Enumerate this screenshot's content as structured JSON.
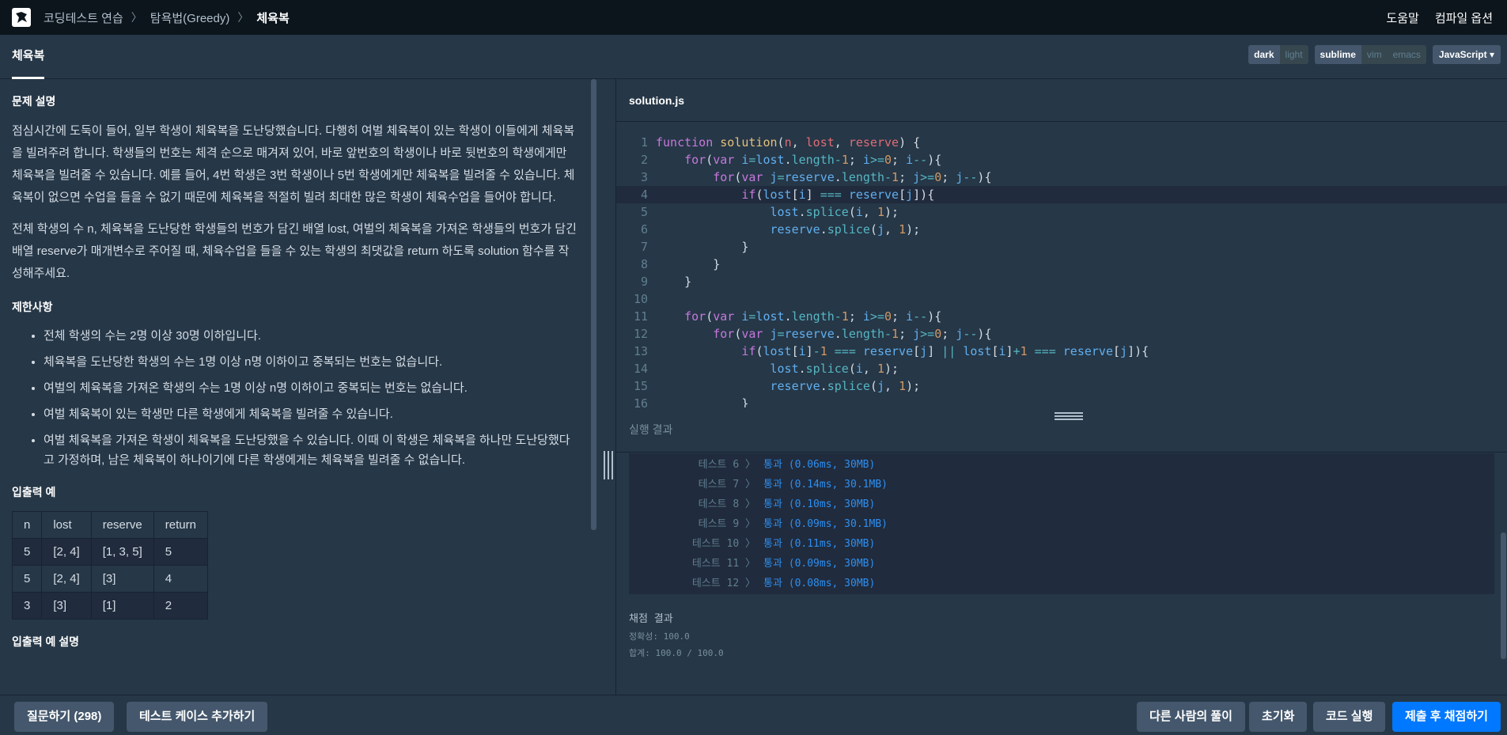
{
  "breadcrumb": {
    "items": [
      "코딩테스트 연습",
      "탐욕법(Greedy)",
      "체육복"
    ]
  },
  "top_links": {
    "help": "도움말",
    "compile_options": "컴파일 옵션"
  },
  "tab": {
    "title": "체육복"
  },
  "toggles": {
    "theme": [
      "dark",
      "light"
    ],
    "keymap": [
      "sublime",
      "vim",
      "emacs"
    ],
    "language": "JavaScript"
  },
  "problem": {
    "heading_desc": "문제 설명",
    "desc_p1": "점심시간에 도둑이 들어, 일부 학생이 체육복을 도난당했습니다. 다행히 여벌 체육복이 있는 학생이 이들에게 체육복을 빌려주려 합니다. 학생들의 번호는 체격 순으로 매겨져 있어, 바로 앞번호의 학생이나 바로 뒷번호의 학생에게만 체육복을 빌려줄 수 있습니다. 예를 들어, 4번 학생은 3번 학생이나 5번 학생에게만 체육복을 빌려줄 수 있습니다. 체육복이 없으면 수업을 들을 수 없기 때문에 체육복을 적절히 빌려 최대한 많은 학생이 체육수업을 들어야 합니다.",
    "desc_p2": "전체 학생의 수 n, 체육복을 도난당한 학생들의 번호가 담긴 배열 lost, 여벌의 체육복을 가져온 학생들의 번호가 담긴 배열 reserve가 매개변수로 주어질 때, 체육수업을 들을 수 있는 학생의 최댓값을 return 하도록 solution 함수를 작성해주세요.",
    "heading_limits": "제한사항",
    "limits": [
      "전체 학생의 수는 2명 이상 30명 이하입니다.",
      "체육복을 도난당한 학생의 수는 1명 이상 n명 이하이고 중복되는 번호는 없습니다.",
      "여벌의 체육복을 가져온 학생의 수는 1명 이상 n명 이하이고 중복되는 번호는 없습니다.",
      "여벌 체육복이 있는 학생만 다른 학생에게 체육복을 빌려줄 수 있습니다.",
      "여벌 체육복을 가져온 학생이 체육복을 도난당했을 수 있습니다. 이때 이 학생은 체육복을 하나만 도난당했다고 가정하며, 남은 체육복이 하나이기에 다른 학생에게는 체육복을 빌려줄 수 없습니다."
    ],
    "heading_io": "입출력 예",
    "io_table": {
      "headers": [
        "n",
        "lost",
        "reserve",
        "return"
      ],
      "rows": [
        [
          "5",
          "[2, 4]",
          "[1, 3, 5]",
          "5"
        ],
        [
          "5",
          "[2, 4]",
          "[3]",
          "4"
        ],
        [
          "3",
          "[3]",
          "[1]",
          "2"
        ]
      ]
    },
    "heading_io_desc": "입출력 예 설명"
  },
  "editor": {
    "filename": "solution.js",
    "lines": [
      "function solution(n, lost, reserve) {",
      "    for(var i=lost.length-1; i>=0; i--){",
      "        for(var j=reserve.length-1; j>=0; j--){",
      "            if(lost[i] === reserve[j]){",
      "                lost.splice(i, 1);",
      "                reserve.splice(j, 1);",
      "            }",
      "        }",
      "    }",
      "",
      "    for(var i=lost.length-1; i>=0; i--){",
      "        for(var j=reserve.length-1; j>=0; j--){",
      "            if(lost[i]-1 === reserve[j] || lost[i]+1 === reserve[j]){",
      "                lost.splice(i, 1);",
      "                reserve.splice(j, 1);",
      "            }"
    ]
  },
  "results": {
    "title": "실행 결과",
    "tests": [
      {
        "label": "테스트 6 〉",
        "result": "통과 (0.06ms, 30MB)"
      },
      {
        "label": "테스트 7 〉",
        "result": "통과 (0.14ms, 30.1MB)"
      },
      {
        "label": "테스트 8 〉",
        "result": "통과 (0.10ms, 30MB)"
      },
      {
        "label": "테스트 9 〉",
        "result": "통과 (0.09ms, 30.1MB)"
      },
      {
        "label": "테스트 10 〉",
        "result": "통과 (0.11ms, 30MB)"
      },
      {
        "label": "테스트 11 〉",
        "result": "통과 (0.09ms, 30MB)"
      },
      {
        "label": "테스트 12 〉",
        "result": "통과 (0.08ms, 30MB)"
      }
    ],
    "grade_title": "채점 결과",
    "accuracy": "정확성: 100.0",
    "total": "합계: 100.0 / 100.0"
  },
  "buttons": {
    "ask": "질문하기 (298)",
    "add_testcase": "테스트 케이스 추가하기",
    "others_solution": "다른 사람의 풀이",
    "reset": "초기화",
    "run": "코드 실행",
    "submit": "제출 후 채점하기"
  }
}
